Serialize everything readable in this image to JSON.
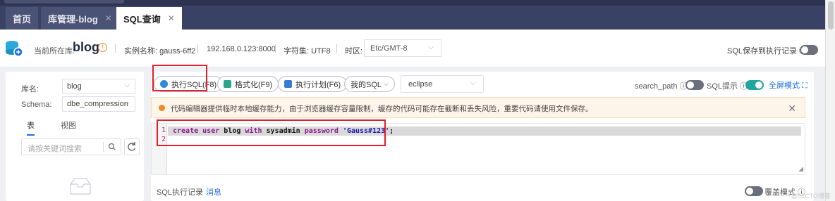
{
  "tabs": [
    {
      "label": "首页",
      "closable": false
    },
    {
      "label": "库管理-blog",
      "closable": true
    },
    {
      "label": "SQL查询",
      "closable": true,
      "active": true
    }
  ],
  "info": {
    "current_db_label": "当前所在库:",
    "db_name": "blog",
    "instance": "实例名称: gauss-6ff2",
    "address": "192.168.0.123:8000",
    "charset": "字符集: UTF8",
    "timezone_label": "时区:",
    "timezone_value": "Etc/GMT-8",
    "save_record": "SQL保存到执行记录 ⓘ",
    "save_record_enabled": false
  },
  "left": {
    "db_label": "库名:",
    "db_value": "blog",
    "schema_label": "Schema:",
    "schema_value": "dbe_compression",
    "tab_table": "表",
    "tab_view": "视图",
    "search_placeholder": "请按关键词搜索"
  },
  "toolbar": {
    "execute": "执行SQL(F8)",
    "format": "格式化(F9)",
    "plan": "执行计划(F6)",
    "my_sql": "我的SQL",
    "theme": "eclipse",
    "search_path": "search_path ⓘ",
    "search_path_enabled": false,
    "sql_hint": "SQL提示 ⓘ",
    "sql_hint_enabled": true,
    "fullscreen": "全屏模式 ⛶"
  },
  "notice": "代码编辑器提供临时本地缓存能力，由于浏览器缓存容量限制，缓存的代码可能存在截断和丢失风险，重要代码请使用文件保存。",
  "editor": {
    "line_numbers": [
      "1",
      "2"
    ],
    "kw_create": "create",
    "kw_user": "user",
    "id_user": "blog",
    "kw_with": "with",
    "kw_sysadmin": "sysadmin",
    "kw_password": "password",
    "str_password": "'Gauss#123'",
    "semicolon": ";"
  },
  "bottom": {
    "tab_history": "SQL执行记录",
    "tab_messages": "消息",
    "overwrite_mode": "覆盖模式 ⓘ",
    "overwrite_enabled": false
  },
  "watermark": "@51CTO博客",
  "colors": {
    "accent": "#1d6fe0",
    "highlight_box": "#e21f2a",
    "toggle_on": "#1fa6a0"
  }
}
